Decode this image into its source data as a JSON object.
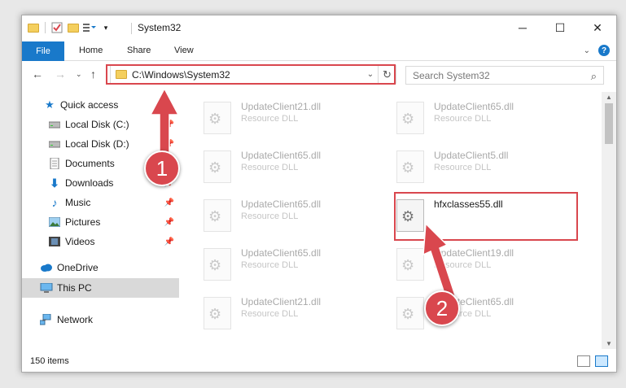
{
  "window": {
    "title": "System32",
    "controls": {
      "minimize": "─",
      "maximize": "☐",
      "close": "✕"
    }
  },
  "ribbon": {
    "file": "File",
    "tabs": [
      "Home",
      "Share",
      "View"
    ]
  },
  "address": {
    "path": "C:\\Windows\\System32",
    "search_placeholder": "Search System32"
  },
  "sidebar": {
    "items": [
      {
        "label": "Quick access",
        "icon": "star-icon",
        "pinned": false
      },
      {
        "label": "Local Disk (C:)",
        "icon": "drive-icon",
        "pinned": true
      },
      {
        "label": "Local Disk (D:)",
        "icon": "drive-icon",
        "pinned": true
      },
      {
        "label": "Documents",
        "icon": "documents-icon",
        "pinned": true
      },
      {
        "label": "Downloads",
        "icon": "download-icon",
        "pinned": true
      },
      {
        "label": "Music",
        "icon": "music-icon",
        "pinned": true
      },
      {
        "label": "Pictures",
        "icon": "pictures-icon",
        "pinned": true
      },
      {
        "label": "Videos",
        "icon": "videos-icon",
        "pinned": true
      },
      {
        "label": "OneDrive",
        "icon": "cloud-icon",
        "pinned": false
      },
      {
        "label": "This PC",
        "icon": "computer-icon",
        "pinned": false
      },
      {
        "label": "Network",
        "icon": "network-icon",
        "pinned": false
      }
    ]
  },
  "files": [
    {
      "name": "UpdateClient21.dll",
      "desc": "Resource DLL"
    },
    {
      "name": "UpdateClient65.dll",
      "desc": "Resource DLL"
    },
    {
      "name": "UpdateClient65.dll",
      "desc": "Resource DLL"
    },
    {
      "name": "UpdateClient5.dll",
      "desc": "Resource DLL"
    },
    {
      "name": "UpdateClient65.dll",
      "desc": "Resource DLL"
    },
    {
      "name": "hfxclasses55.dll",
      "desc": ""
    },
    {
      "name": "UpdateClient65.dll",
      "desc": "Resource DLL"
    },
    {
      "name": "UpdateClient19.dll",
      "desc": "Resource DLL"
    },
    {
      "name": "UpdateClient21.dll",
      "desc": "Resource DLL"
    },
    {
      "name": "UpdateClient65.dll",
      "desc": "Resource DLL"
    }
  ],
  "status": {
    "count": "150 items"
  },
  "annotations": {
    "step1": "1",
    "step2": "2",
    "color": "#d9474e"
  }
}
